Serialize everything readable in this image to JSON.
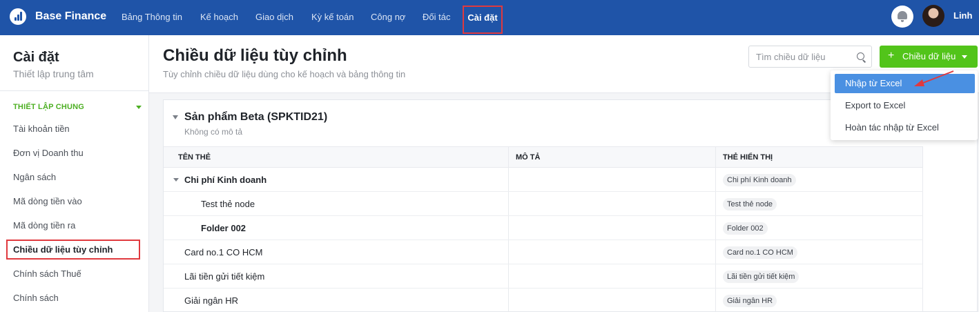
{
  "app": {
    "brand": "Base Finance",
    "nav": [
      "Bảng Thông tin",
      "Kế hoạch",
      "Giao dịch",
      "Kỳ kế toán",
      "Công nợ",
      "Đối tác"
    ],
    "nav_active": "Cài đặt",
    "user": "Linh"
  },
  "sidebar": {
    "title": "Cài đặt",
    "subtitle": "Thiết lập trung tâm",
    "section": "THIẾT LẬP CHUNG",
    "items": [
      "Tài khoản tiền",
      "Đơn vị Doanh thu",
      "Ngân sách",
      "Mã dòng tiền vào",
      "Mã dòng tiền ra",
      "Chiều dữ liệu tùy chỉnh",
      "Chính sách Thuế",
      "Chính sách"
    ],
    "active_item": "Chiều dữ liệu tùy chỉnh"
  },
  "page": {
    "title": "Chiều dữ liệu tùy chỉnh",
    "subtitle": "Tùy chỉnh chiều dữ liệu dùng cho kế hoạch và bảng thông tin",
    "search_placeholder": "Tìm chiều dữ liệu",
    "add_button": "Chiều dữ liệu"
  },
  "dropdown": {
    "items": [
      "Nhập từ Excel",
      "Export to Excel",
      "Hoàn tác nhập từ Excel"
    ],
    "selected": "Nhập từ Excel"
  },
  "dimension": {
    "title": "Sản phẩm Beta (SPKTID21)",
    "description": "Không có mô tả",
    "columns": [
      "TÊN THẺ",
      "MÔ TẢ",
      "THẺ HIỂN THỊ"
    ],
    "rows": [
      {
        "name": "Chi phí Kinh doanh",
        "description": "",
        "display": "Chi phí Kinh doanh"
      },
      {
        "name": "Test thẻ node",
        "description": "",
        "display": "Test thẻ node"
      },
      {
        "name": "Folder 002",
        "description": "",
        "display": "Folder 002"
      },
      {
        "name": "Card no.1 CO HCM",
        "description": "",
        "display": "Card no.1 CO HCM"
      },
      {
        "name": "Lãi tiền gửi tiết kiệm",
        "description": "",
        "display": "Lãi tiền gửi tiết kiệm"
      },
      {
        "name": "Giải ngân HR",
        "description": "",
        "display": "Giải ngân HR"
      }
    ]
  },
  "colors": {
    "topbar": "#1f54a8",
    "primary_green": "#52c41a",
    "highlight_blue": "#4a90e2",
    "annotation_red": "#e0393e"
  }
}
